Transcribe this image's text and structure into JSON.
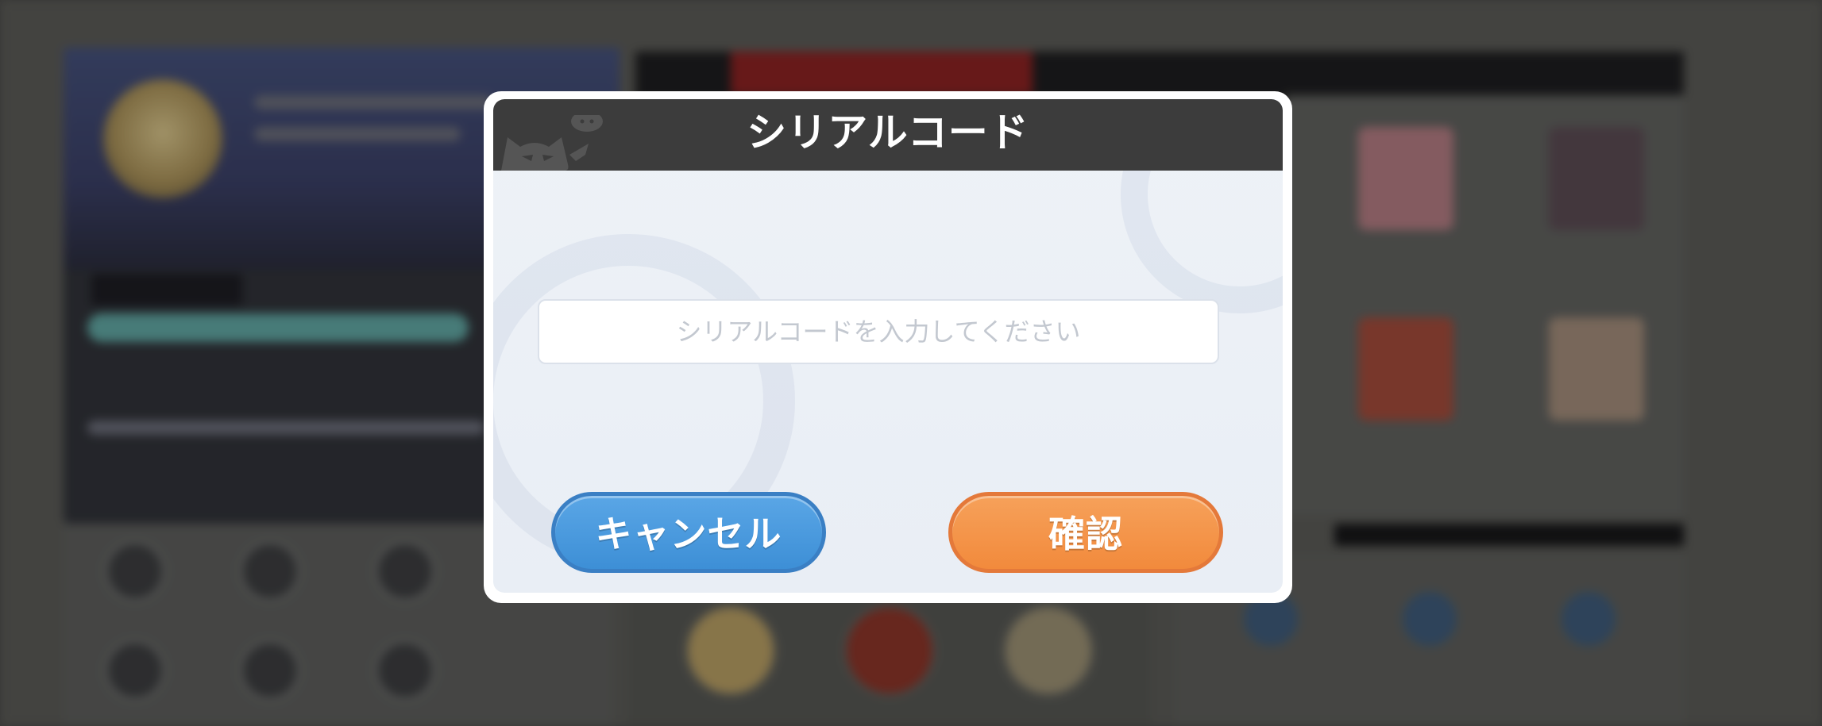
{
  "dialog": {
    "title": "シリアルコード",
    "input": {
      "value": "",
      "placeholder": "シリアルコードを入力してください"
    },
    "cancel_label": "キャンセル",
    "confirm_label": "確認"
  },
  "colors": {
    "header_bg": "#3c3c3c",
    "cancel_button": "#3d8fd6",
    "confirm_button": "#f28a3c",
    "dialog_bg": "#eef2f7"
  },
  "icons": {
    "header_decoration": "cat-mascot-icon"
  }
}
